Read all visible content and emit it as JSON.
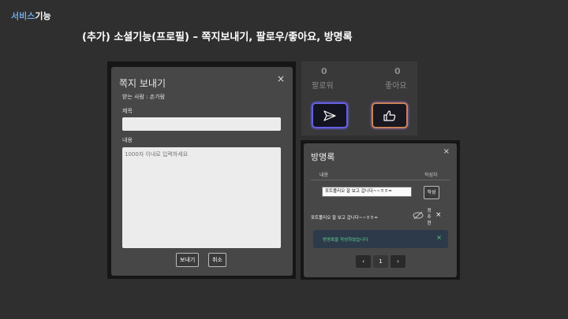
{
  "corner": {
    "part1": "서비스",
    "part2": "기능"
  },
  "title": "(추가) 소셜기능(프로필) – 쪽지보내기, 팔로우/좋아요, 방명록",
  "message": {
    "heading": "쪽지 보내기",
    "close": "×",
    "recipient": "받는 사람 : 손가람",
    "subject_label": "제목",
    "subject_value": "",
    "content_label": "내용",
    "content_placeholder": "1000자 이내로 입력하세요",
    "send_label": "보내기",
    "cancel_label": "취소"
  },
  "stats": {
    "followers_count": "0",
    "followers_label": "팔로워",
    "likes_count": "0",
    "likes_label": "좋아요",
    "send_icon": "paper-plane-icon",
    "like_icon": "thumbs-up-icon",
    "accent_send": "#6660e0",
    "accent_like": "#c68458"
  },
  "guestbook": {
    "heading": "방명록",
    "close": "×",
    "col_content": "내용",
    "col_author": "작성자",
    "input_value": "포트폴리오 잘 보고 갑니다~~ㅎㅎ=",
    "write_label": "작성",
    "entry_text": "포트폴리오 잘 보고 갑니다~~ㅎㅎ=",
    "entry_author": "정주현",
    "entry_delete": "×",
    "toast_text": "방명록을 작성하였습니다",
    "toast_close": "×",
    "toast_color": "#5fd38f",
    "pagination": {
      "prev": "‹",
      "page": "1",
      "next": "›"
    }
  }
}
